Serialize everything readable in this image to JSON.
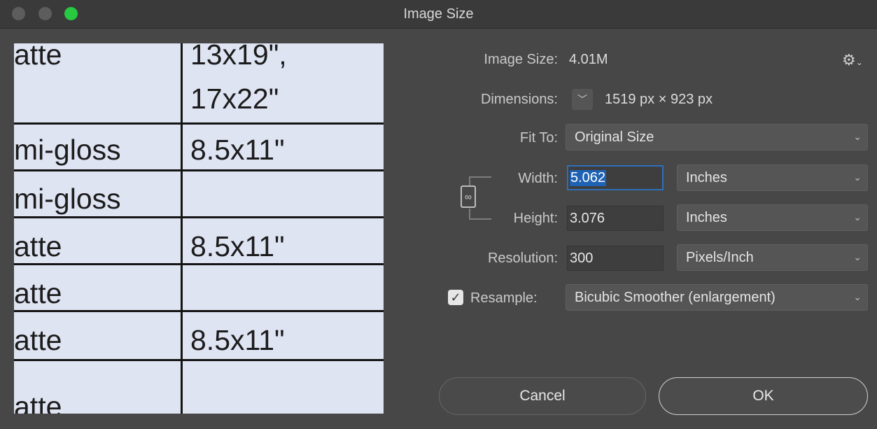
{
  "window": {
    "title": "Image Size"
  },
  "preview": {
    "rows": [
      {
        "c1": "atte",
        "c2": "13x19\","
      },
      {
        "c1": "",
        "c2": "17x22\""
      },
      {
        "c1": "mi-gloss",
        "c2": "8.5x11\""
      },
      {
        "c1": "mi-gloss",
        "c2": ""
      },
      {
        "c1": "atte",
        "c2": "8.5x11\""
      },
      {
        "c1": "atte",
        "c2": ""
      },
      {
        "c1": "atte",
        "c2": "8.5x11\""
      },
      {
        "c1": "atte",
        "c2": ""
      }
    ]
  },
  "image_size": {
    "label": "Image Size:",
    "value": "4.01M"
  },
  "dimensions": {
    "label": "Dimensions:",
    "value": "1519 px  ×  923 px"
  },
  "fit_to": {
    "label": "Fit To:",
    "value": "Original Size"
  },
  "width": {
    "label": "Width:",
    "value": "5.062",
    "unit": "Inches"
  },
  "height": {
    "label": "Height:",
    "value": "3.076",
    "unit": "Inches"
  },
  "resolution": {
    "label": "Resolution:",
    "value": "300",
    "unit": "Pixels/Inch"
  },
  "resample": {
    "label": "Resample:",
    "checked": true,
    "value": "Bicubic Smoother (enlargement)"
  },
  "buttons": {
    "cancel": "Cancel",
    "ok": "OK"
  },
  "icons": {
    "gear": "gear-icon",
    "chevron": "chevron-down-icon",
    "link": "link-icon",
    "check": "checkmark-icon"
  }
}
